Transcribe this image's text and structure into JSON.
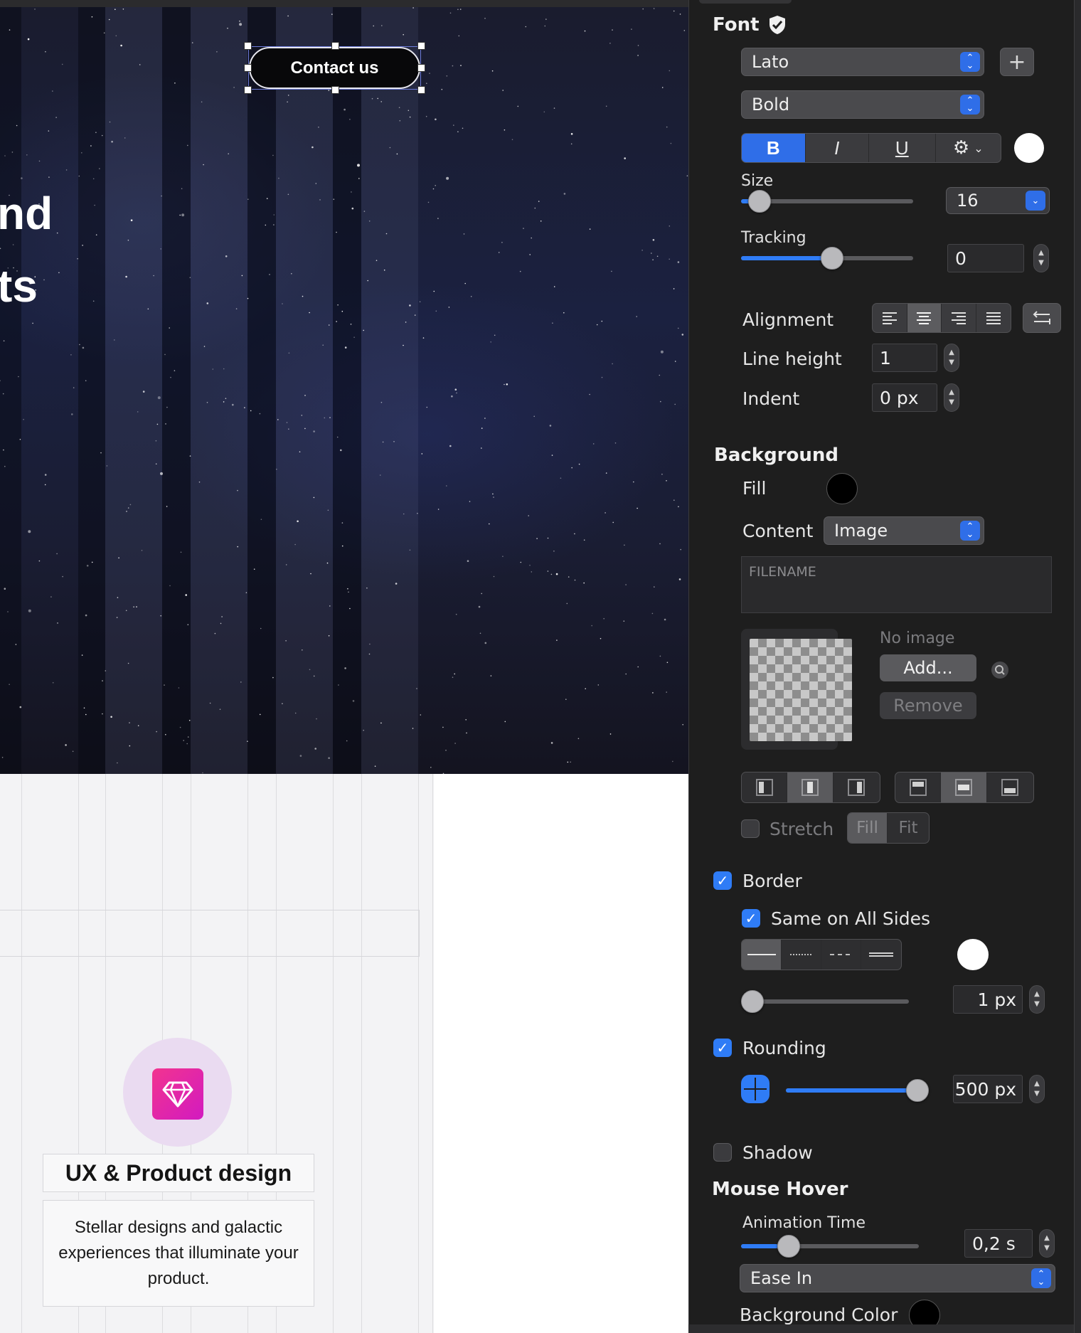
{
  "canvas": {
    "hero_fragment_1": "nd",
    "hero_fragment_2": "ts",
    "contact_button": "Contact us",
    "card_title": "UX & Product design",
    "card_description": "Stellar designs and galactic experiences that illuminate your product."
  },
  "inspector": {
    "font": {
      "title": "Font",
      "family": "Lato",
      "weight": "Bold",
      "style_buttons": [
        "B",
        "I",
        "U"
      ],
      "size_label": "Size",
      "size_value": "16",
      "tracking_label": "Tracking",
      "tracking_value": "0",
      "alignment_label": "Alignment",
      "line_height_label": "Line height",
      "line_height_value": "1",
      "indent_label": "Indent",
      "indent_value": "0 px",
      "text_color": "#ffffff"
    },
    "background": {
      "title": "Background",
      "fill_label": "Fill",
      "fill_color": "#000000",
      "content_label": "Content",
      "content_value": "Image",
      "filename_placeholder": "FILENAME",
      "no_image": "No image",
      "add_button": "Add...",
      "remove_button": "Remove",
      "stretch_label": "Stretch",
      "fill_option": "Fill",
      "fit_option": "Fit"
    },
    "border": {
      "label": "Border",
      "same_all_sides": "Same on All Sides",
      "color": "#ffffff",
      "width_value": "1 px"
    },
    "rounding": {
      "label": "Rounding",
      "value": "500 px"
    },
    "shadow": {
      "label": "Shadow"
    },
    "mouse_hover": {
      "title": "Mouse Hover",
      "animation_time_label": "Animation Time",
      "animation_time_value": "0,2 s",
      "easing": "Ease In",
      "background_color_label": "Background Color"
    },
    "accent_color": "#2f7cf6"
  }
}
